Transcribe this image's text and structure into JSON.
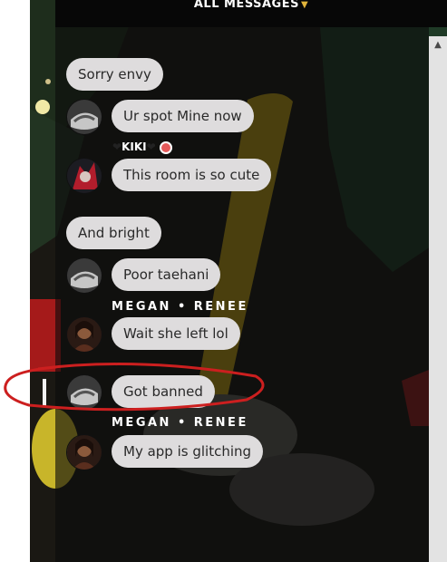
{
  "header": {
    "title": "ALL MESSAGES",
    "dropdown_icon": "chevron-down-icon"
  },
  "colors": {
    "accent": "#e1b33a",
    "bubble": "#dedcdd",
    "highlight": "#cc1f1f"
  },
  "messages": [
    {
      "text": "Sorry envy"
    },
    {
      "text": "Ur spot Mine now"
    },
    {
      "user": "KIKI",
      "text": "This room is so cute"
    },
    {
      "text": "And bright"
    },
    {
      "text": "Poor taehani"
    },
    {
      "user": "MEGAN • RENEE",
      "text": "Wait she left lol"
    },
    {
      "text": "Got banned"
    },
    {
      "user": "MEGAN • RENEE",
      "text": "My app is glitching"
    }
  ]
}
